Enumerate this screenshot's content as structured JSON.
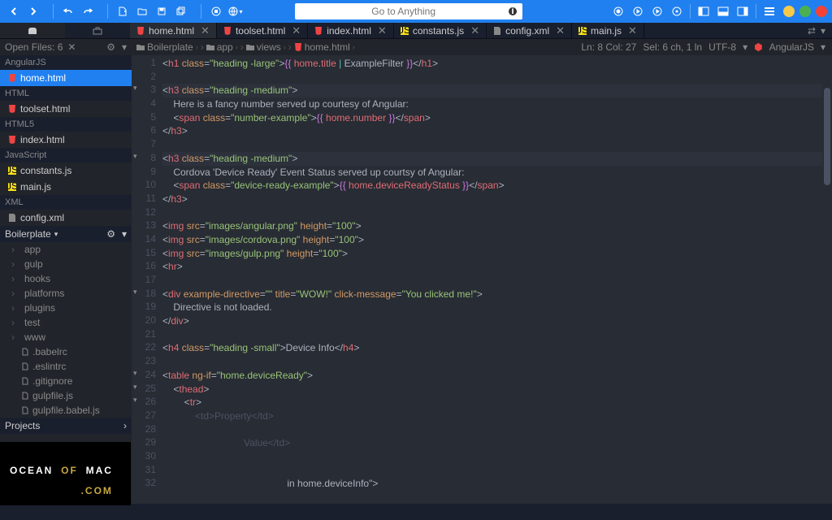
{
  "search_placeholder": "Go to Anything",
  "open_files_label": "Open Files: 6",
  "breadcrumb": [
    "Boilerplate",
    "app",
    "views",
    "home.html"
  ],
  "status": {
    "pos": "Ln: 8 Col: 27",
    "sel": "Sel: 6 ch, 1 ln",
    "enc": "UTF-8",
    "lang": "AngularJS"
  },
  "tabs": [
    {
      "icon": "html5",
      "label": "home.html",
      "active": true
    },
    {
      "icon": "html5",
      "label": "toolset.html"
    },
    {
      "icon": "html5",
      "label": "index.html"
    },
    {
      "icon": "js",
      "label": "constants.js"
    },
    {
      "icon": "xml",
      "label": "config.xml"
    },
    {
      "icon": "js",
      "label": "main.js"
    }
  ],
  "sidebar": {
    "groups": [
      {
        "label": "AngularJS",
        "items": [
          {
            "icon": "html5",
            "label": "home.html",
            "active": true
          }
        ]
      },
      {
        "label": "HTML",
        "items": [
          {
            "icon": "html5",
            "label": "toolset.html"
          }
        ]
      },
      {
        "label": "HTML5",
        "items": [
          {
            "icon": "html5",
            "label": "index.html"
          }
        ]
      },
      {
        "label": "JavaScript",
        "items": [
          {
            "icon": "js",
            "label": "constants.js"
          },
          {
            "icon": "js",
            "label": "main.js"
          }
        ]
      },
      {
        "label": "XML",
        "items": [
          {
            "icon": "xml",
            "label": "config.xml"
          }
        ]
      }
    ],
    "project": "Boilerplate",
    "tree": [
      "app",
      "gulp",
      "hooks",
      "platforms",
      "plugins",
      "test",
      "www",
      ".babelrc",
      ".eslintrc",
      ".gitignore",
      "gulpfile.js",
      "gulpfile.babel.js"
    ],
    "projects_label": "Projects"
  },
  "code": [
    {
      "n": 1,
      "h": "<span class='t-punc'>&lt;</span><span class='t-tag'>h1</span> <span class='t-attr'>class</span><span class='t-punc'>=</span><span class='t-str'>\"heading -large\"</span><span class='t-punc'>&gt;</span><span class='t-exp'>{{</span> <span class='t-var'>home</span><span class='t-punc'>.</span><span class='t-var'>title</span> <span class='t-op'>|</span> <span class='t-txt'>ExampleFilter</span> <span class='t-exp'>}}</span><span class='t-punc'>&lt;/</span><span class='t-tag'>h1</span><span class='t-punc'>&gt;</span>"
    },
    {
      "n": 2,
      "h": ""
    },
    {
      "n": 3,
      "f": true,
      "hl": true,
      "h": "<span class='t-punc'>&lt;</span><span class='t-tag'>h3</span> <span class='t-attr'>class</span><span class='t-punc'>=</span><span class='t-str'>\"heading -medium\"</span><span class='t-punc'>&gt;</span>"
    },
    {
      "n": 4,
      "h": "    <span class='t-txt'>Here is a fancy number served up courtesy of Angular:</span>"
    },
    {
      "n": 5,
      "h": "    <span class='t-punc'>&lt;</span><span class='t-tag'>span</span> <span class='t-attr'>class</span><span class='t-punc'>=</span><span class='t-str'>\"number-example\"</span><span class='t-punc'>&gt;</span><span class='t-exp'>{{</span> <span class='t-var'>home</span><span class='t-punc'>.</span><span class='t-var'>number</span> <span class='t-exp'>}}</span><span class='t-punc'>&lt;/</span><span class='t-tag'>span</span><span class='t-punc'>&gt;</span>"
    },
    {
      "n": 6,
      "h": "<span class='t-punc'>&lt;/</span><span class='t-tag'>h3</span><span class='t-punc'>&gt;</span>"
    },
    {
      "n": 7,
      "h": ""
    },
    {
      "n": 8,
      "f": true,
      "hl": true,
      "h": "<span class='t-punc'>&lt;</span><span class='t-tag'>h3</span> <span class='t-attr'>class</span><span class='t-punc'>=</span><span class='t-str'>\"heading -medium\"</span><span class='t-punc'>&gt;</span>"
    },
    {
      "n": 9,
      "h": "    <span class='t-txt'>Cordova 'Device Ready' Event Status served up courtsy of Angular:</span>"
    },
    {
      "n": 10,
      "h": "    <span class='t-punc'>&lt;</span><span class='t-tag'>span</span> <span class='t-attr'>class</span><span class='t-punc'>=</span><span class='t-str'>\"device-ready-example\"</span><span class='t-punc'>&gt;</span><span class='t-exp'>{{</span> <span class='t-var'>home</span><span class='t-punc'>.</span><span class='t-var'>deviceReadyStatus</span> <span class='t-exp'>}}</span><span class='t-punc'>&lt;/</span><span class='t-tag'>span</span><span class='t-punc'>&gt;</span>"
    },
    {
      "n": 11,
      "h": "<span class='t-punc'>&lt;/</span><span class='t-tag'>h3</span><span class='t-punc'>&gt;</span>"
    },
    {
      "n": 12,
      "h": ""
    },
    {
      "n": 13,
      "h": "<span class='t-punc'>&lt;</span><span class='t-tag'>img</span> <span class='t-attr'>src</span><span class='t-punc'>=</span><span class='t-str'>\"images/angular.png\"</span> <span class='t-attr'>height</span><span class='t-punc'>=</span><span class='t-str'>\"100\"</span><span class='t-punc'>&gt;</span>"
    },
    {
      "n": 14,
      "h": "<span class='t-punc'>&lt;</span><span class='t-tag'>img</span> <span class='t-attr'>src</span><span class='t-punc'>=</span><span class='t-str'>\"images/cordova.png\"</span> <span class='t-attr'>height</span><span class='t-punc'>=</span><span class='t-str'>\"100\"</span><span class='t-punc'>&gt;</span>"
    },
    {
      "n": 15,
      "h": "<span class='t-punc'>&lt;</span><span class='t-tag'>img</span> <span class='t-attr'>src</span><span class='t-punc'>=</span><span class='t-str'>\"images/gulp.png\"</span> <span class='t-attr'>height</span><span class='t-punc'>=</span><span class='t-str'>\"100\"</span><span class='t-punc'>&gt;</span>"
    },
    {
      "n": 16,
      "h": "<span class='t-punc'>&lt;</span><span class='t-tag'>hr</span><span class='t-punc'>&gt;</span>"
    },
    {
      "n": 17,
      "h": ""
    },
    {
      "n": 18,
      "f": true,
      "h": "<span class='t-punc'>&lt;</span><span class='t-tag'>div</span> <span class='t-attr'>example-directive</span><span class='t-punc'>=</span><span class='t-str'>\"\"</span> <span class='t-attr'>title</span><span class='t-punc'>=</span><span class='t-str'>\"WOW!\"</span> <span class='t-attr'>click-message</span><span class='t-punc'>=</span><span class='t-str'>\"You clicked me!\"</span><span class='t-punc'>&gt;</span>"
    },
    {
      "n": 19,
      "h": "    <span class='t-txt'>Directive is not loaded.</span>"
    },
    {
      "n": 20,
      "h": "<span class='t-punc'>&lt;/</span><span class='t-tag'>div</span><span class='t-punc'>&gt;</span>"
    },
    {
      "n": 21,
      "h": ""
    },
    {
      "n": 22,
      "h": "<span class='t-punc'>&lt;</span><span class='t-tag'>h4</span> <span class='t-attr'>class</span><span class='t-punc'>=</span><span class='t-str'>\"heading -small\"</span><span class='t-punc'>&gt;</span><span class='t-txt'>Device Info</span><span class='t-punc'>&lt;/</span><span class='t-tag'>h4</span><span class='t-punc'>&gt;</span>"
    },
    {
      "n": 23,
      "h": ""
    },
    {
      "n": 24,
      "f": true,
      "h": "<span class='t-punc'>&lt;</span><span class='t-tag'>table</span> <span class='t-attr'>ng-if</span><span class='t-punc'>=</span><span class='t-str'>\"home.deviceReady\"</span><span class='t-punc'>&gt;</span>"
    },
    {
      "n": 25,
      "f": true,
      "h": "    <span class='t-punc'>&lt;</span><span class='t-tag'>thead</span><span class='t-punc'>&gt;</span>"
    },
    {
      "n": 26,
      "f": true,
      "h": "        <span class='t-punc'>&lt;</span><span class='t-tag'>tr</span><span class='t-punc'>&gt;</span>"
    },
    {
      "n": 27,
      "h": "            <span style='color:#4b5263'>&lt;td&gt;Property&lt;/td&gt;</span>"
    },
    {
      "n": 28,
      "h": ""
    },
    {
      "n": 29,
      "h": "                              <span style='color:#4b5263'>Value&lt;/td&gt;</span>"
    },
    {
      "n": 30,
      "h": ""
    },
    {
      "n": 31,
      "h": ""
    },
    {
      "n": 32,
      "h": "                                              <span class='t-txt'>in home.deviceInfo\"</span><span class='t-punc'>&gt;</span>"
    }
  ],
  "watermark": {
    "l1a": "OCEAN",
    "l1b": "OF",
    "l1c": "MAC",
    "l2": ".COM"
  }
}
